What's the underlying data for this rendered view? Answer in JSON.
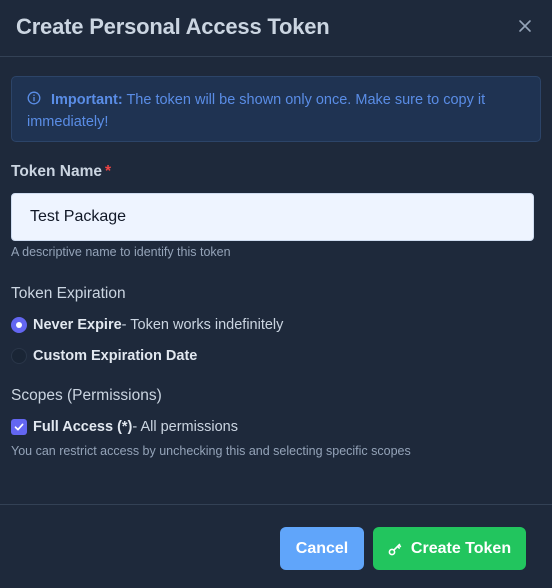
{
  "modal": {
    "title": "Create Personal Access Token",
    "close_icon": "close-icon"
  },
  "alert": {
    "icon": "info-icon",
    "strong": "Important:",
    "text": " The token will be shown only once. Make sure to copy it immediately!"
  },
  "token_name": {
    "label": "Token Name",
    "required_mark": "*",
    "value": "Test Package",
    "help": "A descriptive name to identify this token"
  },
  "expiration": {
    "title": "Token Expiration",
    "options": [
      {
        "label": "Never Expire",
        "description": " - Token works indefinitely",
        "selected": true
      },
      {
        "label": "Custom Expiration Date",
        "description": "",
        "selected": false
      }
    ]
  },
  "scopes": {
    "title": "Scopes (Permissions)",
    "full_access_label": "Full Access (*)",
    "full_access_desc": " - All permissions",
    "full_access_checked": true,
    "help": "You can restrict access by unchecking this and selecting specific scopes"
  },
  "footer": {
    "cancel_label": "Cancel",
    "create_label": "Create Token",
    "create_icon": "key-icon"
  },
  "colors": {
    "background": "#1e293b",
    "accent": "#6366f1",
    "cancel": "#60a5fa",
    "create": "#22c55e",
    "alert_text": "#5a8de6",
    "required": "#ef4444"
  }
}
